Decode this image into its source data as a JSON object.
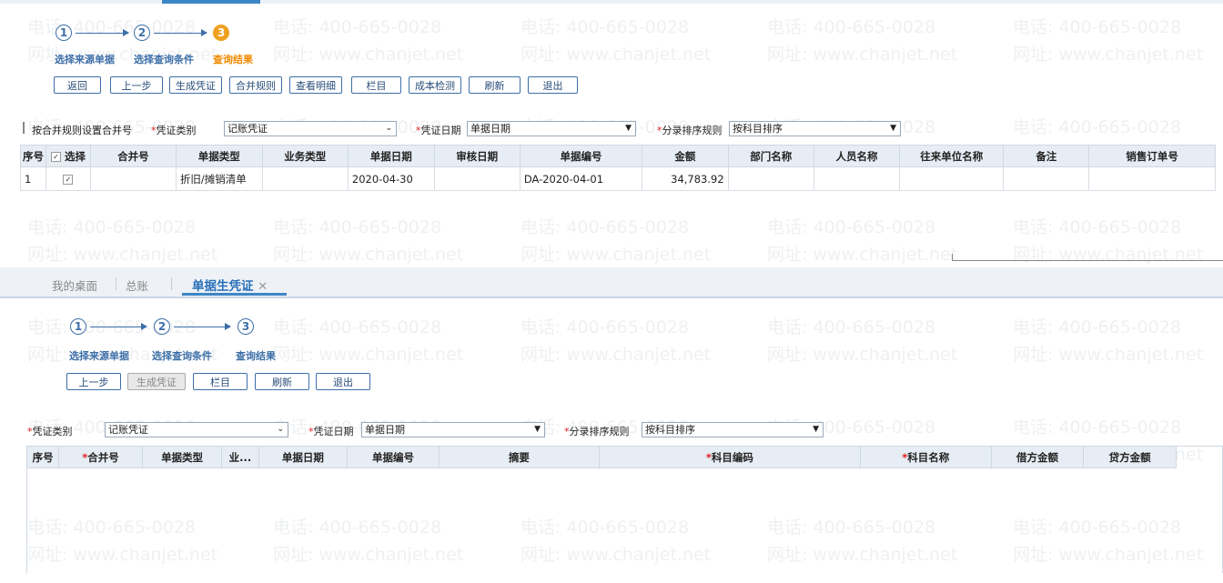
{
  "watermark": {
    "phone": "电话: 400-665-0028",
    "site": "网址: www.chanjet.net"
  },
  "top": {
    "steps": [
      {
        "num": "1",
        "label": "选择来源单据"
      },
      {
        "num": "2",
        "label": "选择查询条件"
      },
      {
        "num": "3",
        "label": "查询结果"
      }
    ],
    "buttons": [
      "返回",
      "上一步",
      "生成凭证",
      "合并规则",
      "查看明细",
      "栏目",
      "成本检测",
      "刷新",
      "退出"
    ],
    "filters": {
      "merge_label": "按合并规则设置合并号",
      "voucher_type_label": "凭证类别",
      "voucher_type_value": "记账凭证",
      "voucher_date_label": "凭证日期",
      "voucher_date_value": "单据日期",
      "sort_label": "分录排序规则",
      "sort_value": "按科目排序"
    },
    "table": {
      "columns": [
        "序号",
        "选择",
        "合并号",
        "单据类型",
        "业务类型",
        "单据日期",
        "审核日期",
        "单据编号",
        "金额",
        "部门名称",
        "人员名称",
        "往来单位名称",
        "备注",
        "销售订单号"
      ],
      "rows": [
        {
          "seq": "1",
          "merge": "",
          "doc_type": "折旧/摊销清单",
          "biz_type": "",
          "doc_date": "2020-04-30",
          "audit_date": "",
          "doc_no": "DA-2020-04-01",
          "amount": "34,783.92",
          "dept": "",
          "person": "",
          "partner": "",
          "remark": "",
          "so": ""
        }
      ]
    }
  },
  "tabs": [
    {
      "label": "我的桌面"
    },
    {
      "label": "总账"
    },
    {
      "label": "单据生凭证",
      "close": "✕"
    }
  ],
  "bottom": {
    "steps": [
      {
        "num": "1",
        "label": "选择来源单据"
      },
      {
        "num": "2",
        "label": "选择查询条件"
      },
      {
        "num": "3",
        "label": "查询结果"
      }
    ],
    "buttons": [
      "上一步",
      "生成凭证",
      "栏目",
      "刷新",
      "退出"
    ],
    "filters": {
      "voucher_type_label": "凭证类别",
      "voucher_type_value": "记账凭证",
      "voucher_date_label": "凭证日期",
      "voucher_date_value": "单据日期",
      "sort_label": "分录排序规则",
      "sort_value": "按科目排序"
    },
    "table": {
      "columns": [
        "序号",
        "合并号",
        "单据类型",
        "业...",
        "单据日期",
        "单据编号",
        "摘要",
        "科目编码",
        "科目名称",
        "借方金额",
        "贷方金额"
      ]
    }
  }
}
